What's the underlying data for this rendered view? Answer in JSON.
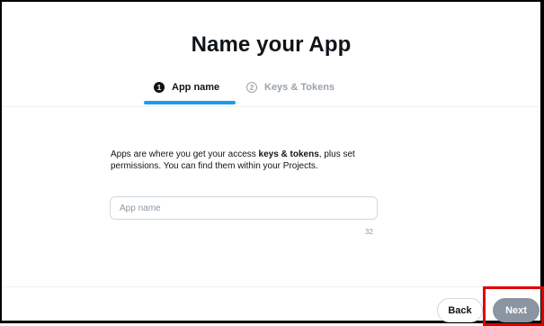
{
  "title": "Name your App",
  "steps": [
    {
      "number": "1",
      "label": "App name"
    },
    {
      "number": "2",
      "label": "Keys & Tokens"
    }
  ],
  "description": {
    "prefix": "Apps are where you get your access ",
    "bold": "keys & tokens",
    "suffix": ", plus set permissions. You can find them within your Projects."
  },
  "app_name_input": {
    "placeholder": "App name",
    "value": "",
    "char_limit": "32"
  },
  "buttons": {
    "back": "Back",
    "next": "Next"
  }
}
